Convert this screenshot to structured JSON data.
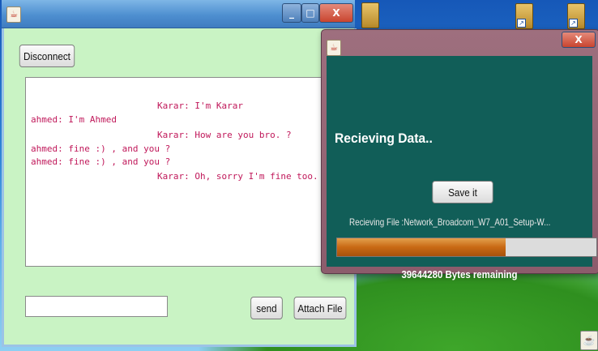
{
  "chat_window": {
    "disconnect_label": "Disconnect",
    "minimize_glyph": "_",
    "maximize_glyph": "□",
    "close_glyph": "X",
    "messages": [
      "Karar: I'm Karar",
      "ahmed: I'm Ahmed",
      "Karar: How are you bro. ?",
      "ahmed: fine :) , and you ?",
      "ahmed: fine :) , and you ?",
      "Karar: Oh, sorry I'm fine too. :)"
    ],
    "input_value": "",
    "send_label": "send",
    "attach_label": "Attach File"
  },
  "receive_dialog": {
    "close_glyph": "X",
    "title": "Recieving Data..",
    "save_label": "Save it",
    "file_label": "Recieving File :Network_Broadcom_W7_A01_Setup-W...",
    "progress_fraction": 0.65,
    "bytes_remaining": "39644280 Bytes remaining"
  },
  "colors": {
    "chat_text": "#c0185a",
    "chat_bg": "#c9f3c4",
    "dialog_bg": "#115e58",
    "progress_fill": "#c86914"
  },
  "icons": [
    "java-icon",
    "folder-shortcut-icon"
  ]
}
